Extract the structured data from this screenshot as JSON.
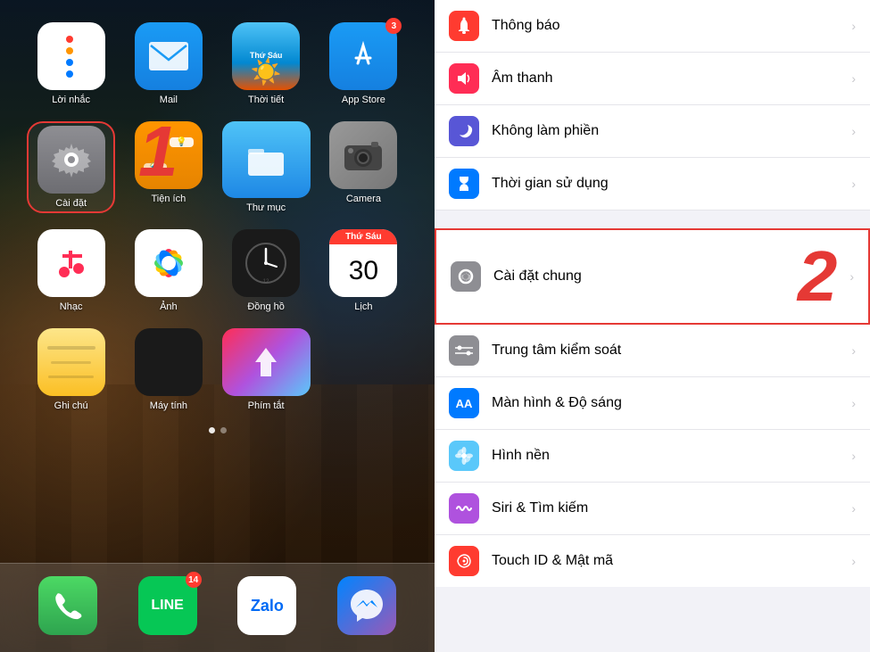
{
  "left": {
    "apps": [
      {
        "id": "reminders",
        "label": "Lời nhắc",
        "icon": "reminders"
      },
      {
        "id": "mail",
        "label": "Mail",
        "icon": "mail"
      },
      {
        "id": "weather",
        "label": "Thời tiết",
        "icon": "weather"
      },
      {
        "id": "appstore",
        "label": "App Store",
        "icon": "appstore",
        "badge": "3"
      },
      {
        "id": "settings",
        "label": "Cài đặt",
        "icon": "settings",
        "highlighted": true
      },
      {
        "id": "utilities",
        "label": "Tiện ích",
        "icon": "utilities"
      },
      {
        "id": "files",
        "label": "Thư mục",
        "icon": "files"
      },
      {
        "id": "camera",
        "label": "Camera",
        "icon": "camera"
      },
      {
        "id": "music",
        "label": "Nhạc",
        "icon": "music"
      },
      {
        "id": "photos",
        "label": "Ảnh",
        "icon": "photos"
      },
      {
        "id": "clock",
        "label": "Đồng hồ",
        "icon": "clock"
      },
      {
        "id": "calendar",
        "label": "Lịch",
        "icon": "calendar"
      },
      {
        "id": "notes",
        "label": "Ghi chú",
        "icon": "notes"
      },
      {
        "id": "calculator",
        "label": "Máy tính",
        "icon": "calculator"
      },
      {
        "id": "shortcuts",
        "label": "Phím tắt",
        "icon": "shortcuts"
      }
    ],
    "step": "1",
    "dock": [
      {
        "id": "phone",
        "label": "Phone",
        "icon": "phone"
      },
      {
        "id": "line",
        "label": "LINE",
        "icon": "line",
        "badge": "14"
      },
      {
        "id": "zalo",
        "label": "Zalo",
        "icon": "zalo"
      },
      {
        "id": "messenger",
        "label": "Messenger",
        "icon": "messenger"
      }
    ]
  },
  "right": {
    "step": "2",
    "settings_items": [
      {
        "id": "notifications",
        "label": "Thông báo",
        "icon_color": "si-red",
        "icon": "bell"
      },
      {
        "id": "sounds",
        "label": "Âm thanh",
        "icon_color": "si-pink",
        "icon": "speaker"
      },
      {
        "id": "do_not_disturb",
        "label": "Không làm phiền",
        "icon_color": "si-purple",
        "icon": "moon"
      },
      {
        "id": "screen_time",
        "label": "Thời gian sử dụng",
        "icon_color": "si-blue-dark",
        "icon": "hourglass"
      },
      {
        "id": "general",
        "label": "Cài đặt chung",
        "icon_color": "si-settings-gray",
        "icon": "gear",
        "highlighted": true
      },
      {
        "id": "control_center",
        "label": "Trung tâm kiểm soát",
        "icon_color": "si-gray",
        "icon": "sliders"
      },
      {
        "id": "display",
        "label": "Màn hình & Độ sáng",
        "icon_color": "si-blue",
        "icon": "aa"
      },
      {
        "id": "wallpaper",
        "label": "Hình nền",
        "icon_color": "si-teal",
        "icon": "flower"
      },
      {
        "id": "siri",
        "label": "Siri & Tìm kiếm",
        "icon_color": "si-purple2",
        "icon": "siri"
      },
      {
        "id": "touch_id",
        "label": "Touch ID & Mật mã",
        "icon_color": "si-red2",
        "icon": "fingerprint"
      }
    ]
  }
}
